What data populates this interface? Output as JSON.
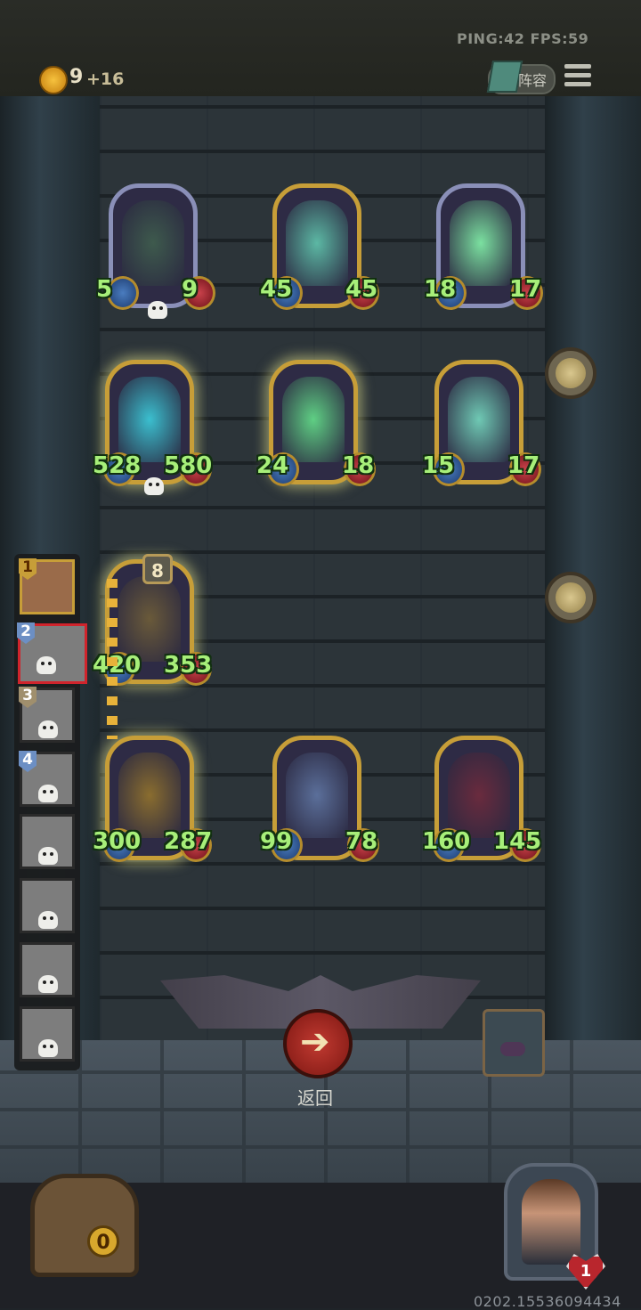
{
  "topbar": {
    "ping_fps": "PING:42  FPS:59",
    "gold": "9",
    "gold_income": "+16",
    "lineup_label": "阵容"
  },
  "opponent_board": [
    {
      "attack": "5",
      "health": "9",
      "style": "ghost",
      "dead": true,
      "art_color": "#3e5a4d"
    },
    {
      "attack": "45",
      "health": "45",
      "style": "gold",
      "dead": false,
      "art_color": "#5cb8a4"
    },
    {
      "attack": "18",
      "health": "17",
      "style": "ghost",
      "dead": false,
      "art_color": "#7be0a0"
    },
    {
      "attack": "528",
      "health": "580",
      "style": "gold-glow",
      "dead": true,
      "art_color": "#3bbfcf"
    },
    {
      "attack": "24",
      "health": "18",
      "style": "gold-glow",
      "dead": false,
      "art_color": "#5fcf84"
    },
    {
      "attack": "15",
      "health": "17",
      "style": "gold",
      "dead": false,
      "art_color": "#6fc9b4"
    }
  ],
  "player_board": [
    {
      "attack": "420",
      "health": "353",
      "style": "gold-glow",
      "art_color": "#6a5a3a"
    },
    {
      "attack": "300",
      "health": "287",
      "style": "gold-glow",
      "art_color": "#8a6d2f"
    },
    {
      "attack": "99",
      "health": "78",
      "style": "gold",
      "art_color": "#5b6f9a"
    },
    {
      "attack": "160",
      "health": "145",
      "style": "gold",
      "art_color": "#6a2b3e"
    }
  ],
  "tavern_tier": "8",
  "players": [
    {
      "rank": "1"
    },
    {
      "rank": "2"
    },
    {
      "rank": "3"
    },
    {
      "rank": "4"
    },
    {
      "rank": ""
    },
    {
      "rank": ""
    },
    {
      "rank": ""
    },
    {
      "rank": ""
    }
  ],
  "back_button": {
    "label": "返回",
    "icon": "arrow-left-icon"
  },
  "treasure_count": "0",
  "hero_lives": "1",
  "game_id": "0202.15536094434",
  "colors": {
    "stat_green": "#a7ef79",
    "gold_frame": "#c79e38",
    "back_red": "#c13a31"
  }
}
